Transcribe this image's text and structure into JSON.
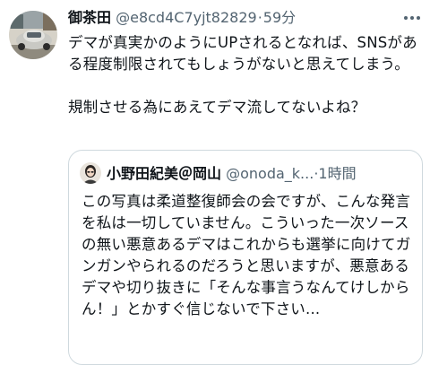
{
  "tweet": {
    "author_name": "御茶田",
    "author_handle": "@e8cd4C7yjt82829",
    "separator": "·",
    "time": "59分",
    "more_icon": "more-horizontal-icon",
    "text": "デマが真実かのようにUPされるとなれば、SNSがある程度制限されてもしょうがないと思えてしまう。\n\n規制させる為にあえてデマ流してないよね？"
  },
  "quote": {
    "author_name": "小野田紀美＠岡山",
    "author_handle": "@onoda_k...",
    "separator": "·",
    "time": "1時間",
    "text": "この写真は柔道整復師会の会ですが、こんな発言を私は一切していません。こういった一次ソースの無い悪意あるデマはこれからも選挙に向けてガンガンやられるのだろうと思いますが、悪意あるデマや切り抜きに「そんな事言うなんてけしからん！」とかすぐ信じないで下さい..."
  }
}
